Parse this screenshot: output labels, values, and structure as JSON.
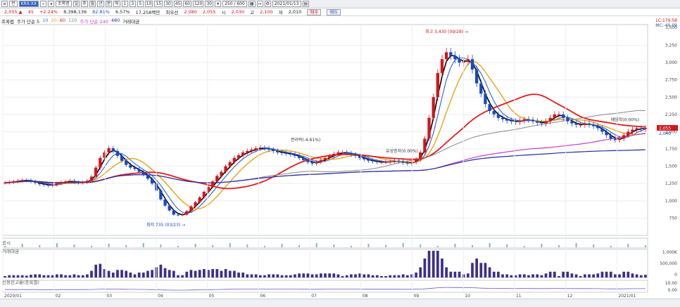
{
  "toolbar": {
    "period": "전",
    "code": "KRX:XX",
    "name": "조록명",
    "units": [
      "1",
      "3",
      "5",
      "10",
      "15",
      "30",
      "45",
      "60",
      "120",
      "30"
    ],
    "count": "250 / 600",
    "date": "2021/01/13"
  },
  "quote": {
    "price": "2,055 ▲",
    "change": "45",
    "pct": "+2.24%",
    "volume": "8,398,136",
    "ratio": "82.81%",
    "ratio2": "6.57%",
    "amount": "17,258백만",
    "prev_label": "최우선",
    "v1": "2,080",
    "v2": "2,055",
    "open_label": "시",
    "open": "2,030",
    "high_label": "고",
    "high": "2,100",
    "low_label": "저",
    "low": "2,010",
    "buy": "매수",
    "sell": "매도"
  },
  "legend": {
    "ma_label": "주가 단순 5",
    "ma_vals": [
      "10",
      "20",
      "60",
      "120"
    ],
    "ma2_label": "주가 단순 240",
    "ma2_val": "480",
    "vol_label": "거래대금",
    "candle_label": "조록법"
  },
  "panels": {
    "notice_label": "공시",
    "volume_label": "거래대금",
    "credit_label": "신용잔고율(종목별)"
  },
  "chart_data": {
    "type": "candlestick",
    "price_ticks": [
      750,
      1000,
      1250,
      1500,
      1750,
      2000,
      2250,
      2500,
      2750,
      3000,
      3250
    ],
    "price_tick_labels": [
      "750",
      "1,000",
      "1,250",
      "1,500",
      "1,750",
      "2,000",
      "2,250",
      "2,500",
      "2,750",
      "3,000",
      "3,250"
    ],
    "top_tick_label": "3,500",
    "ylim": [
      500,
      3550
    ],
    "x_labels": [
      "2020/01",
      "02",
      "03",
      "04",
      "05",
      "06",
      "07",
      "08",
      "09",
      "10",
      "11",
      "12",
      "2021/01"
    ],
    "right_labels": [
      "LC:179.58",
      "MC:-40.09"
    ],
    "current_price_label": "2,055",
    "current_price_label2": "2,040",
    "annotations": {
      "high": "최고 3,430 (09/28)",
      "low": "최저 735 (03/23)",
      "a1": "권리락(-4.61%)",
      "a2": "유상증자(0.00%)",
      "a3": "배당락(0.00%)"
    },
    "volume_ticks": [
      "1,000K",
      "500,000",
      "0"
    ],
    "credit_ticks": [
      "10.00",
      "0.00"
    ],
    "closes": [
      1260,
      1270,
      1280,
      1290,
      1300,
      1295,
      1280,
      1260,
      1240,
      1230,
      1220,
      1230,
      1250,
      1270,
      1280,
      1290,
      1270,
      1260,
      1270,
      1290,
      1350,
      1480,
      1620,
      1700,
      1760,
      1720,
      1650,
      1580,
      1520,
      1480,
      1460,
      1420,
      1380,
      1320,
      1250,
      1150,
      1020,
      930,
      860,
      800,
      790,
      800,
      850,
      920,
      980,
      1050,
      1130,
      1200,
      1280,
      1360,
      1420,
      1500,
      1560,
      1620,
      1660,
      1700,
      1720,
      1740,
      1760,
      1770,
      1760,
      1740,
      1720,
      1700,
      1690,
      1680,
      1670,
      1650,
      1620,
      1590,
      1560,
      1540,
      1560,
      1590,
      1620,
      1650,
      1680,
      1700,
      1700,
      1690,
      1670,
      1650,
      1620,
      1600,
      1580,
      1570,
      1560,
      1560,
      1560,
      1570,
      1580,
      1570,
      1550,
      1540,
      1560,
      1600,
      1700,
      1900,
      2200,
      2500,
      2850,
      3050,
      3150,
      3100,
      3050,
      3000,
      3020,
      3050,
      2900,
      2700,
      2550,
      2400,
      2300,
      2250,
      2200,
      2180,
      2160,
      2150,
      2140,
      2160,
      2180,
      2170,
      2150,
      2130,
      2120,
      2150,
      2200,
      2250,
      2250,
      2200,
      2150,
      2120,
      2100,
      2100,
      2120,
      2100,
      2080,
      2050,
      2000,
      1950,
      1900,
      1880,
      1900,
      1950,
      2000,
      2030,
      2050,
      2040,
      2055
    ]
  },
  "colors": {
    "up": "#d4141a",
    "down": "#1649c8",
    "ma5": "#000000",
    "ma10": "#3a6fd8",
    "ma20": "#e8a317",
    "ma60": "#e01c1c",
    "ma120": "#888888",
    "ma240": "#c93fc0",
    "ma480": "#1f2f9a",
    "volume": "#3b2f8a",
    "credit": "#6a5acd",
    "notice": "#7fbf9a"
  }
}
